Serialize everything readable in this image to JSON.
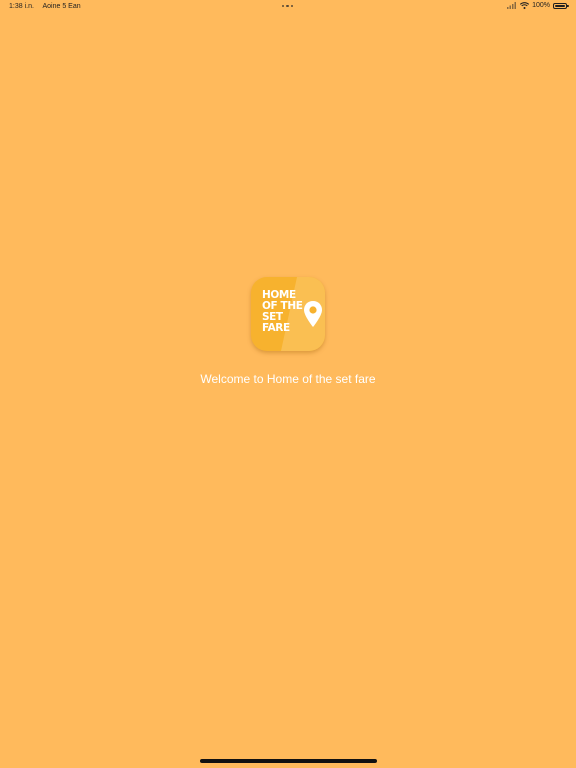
{
  "status_bar": {
    "time": "1:38 i.n.",
    "date": "Aoine 5 Ean",
    "battery_percent": "100%",
    "icons": [
      "signal-icon",
      "wifi-icon",
      "battery-icon"
    ]
  },
  "app_icon": {
    "logo_lines": [
      "HOME",
      "OF THE",
      "SET",
      "FARE"
    ],
    "icon": "location-pin-icon"
  },
  "welcome_text": "Welcome to Home of the set fare",
  "colors": {
    "background": "#FFBA5C",
    "icon_background": "#F7B22E",
    "text": "#FFFFFF"
  }
}
